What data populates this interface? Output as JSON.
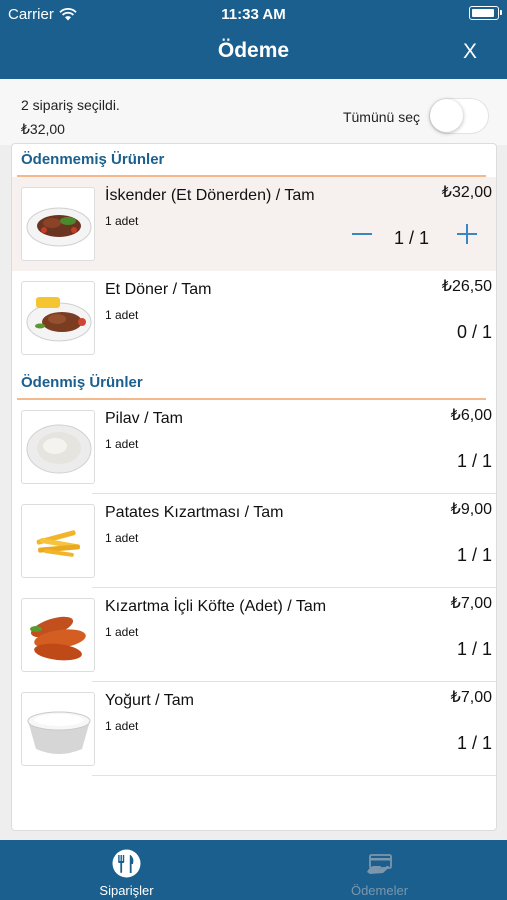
{
  "status_bar": {
    "carrier": "Carrier",
    "time": "11:33 AM"
  },
  "header": {
    "title": "Ödeme",
    "close_label": "X"
  },
  "summary": {
    "selected_count": "2 sipariş seçildi.",
    "total": "₺32,00",
    "select_all_label": "Tümünü seç",
    "select_all_on": false
  },
  "sections": [
    {
      "title": "Ödenmemiş Ürünler",
      "items": [
        {
          "name": "İskender (Et Dönerden) / Tam",
          "quantity": "1 adet",
          "price": "₺32,00",
          "count": "1 / 1",
          "selected": true,
          "image": "iskender"
        },
        {
          "name": "Et Döner / Tam",
          "quantity": "1 adet",
          "price": "₺26,50",
          "count": "0 / 1",
          "selected": false,
          "image": "et-doner"
        }
      ]
    },
    {
      "title": "Ödenmiş Ürünler",
      "items": [
        {
          "name": "Pilav / Tam",
          "quantity": "1 adet",
          "price": "₺6,00",
          "count": "1 / 1",
          "image": "pilav"
        },
        {
          "name": "Patates Kızartması / Tam",
          "quantity": "1 adet",
          "price": "₺9,00",
          "count": "1 / 1",
          "image": "patates"
        },
        {
          "name": "Kızartma İçli Köfte (Adet) / Tam",
          "quantity": "1 adet",
          "price": "₺7,00",
          "count": "1 / 1",
          "image": "icli-kofte"
        },
        {
          "name": "Yoğurt / Tam",
          "quantity": "1 adet",
          "price": "₺7,00",
          "count": "1 / 1",
          "image": "yogurt"
        }
      ]
    }
  ],
  "tabbar": {
    "tabs": [
      {
        "label": "Siparişler",
        "icon": "fork-knife-icon",
        "active": true
      },
      {
        "label": "Ödemeler",
        "icon": "payment-card-icon",
        "active": false
      }
    ]
  },
  "colors": {
    "primary": "#1a5f8e",
    "accent_line": "#f3b98d",
    "selected_row": "#f6f0ee",
    "stepper": "#3a86c3"
  }
}
